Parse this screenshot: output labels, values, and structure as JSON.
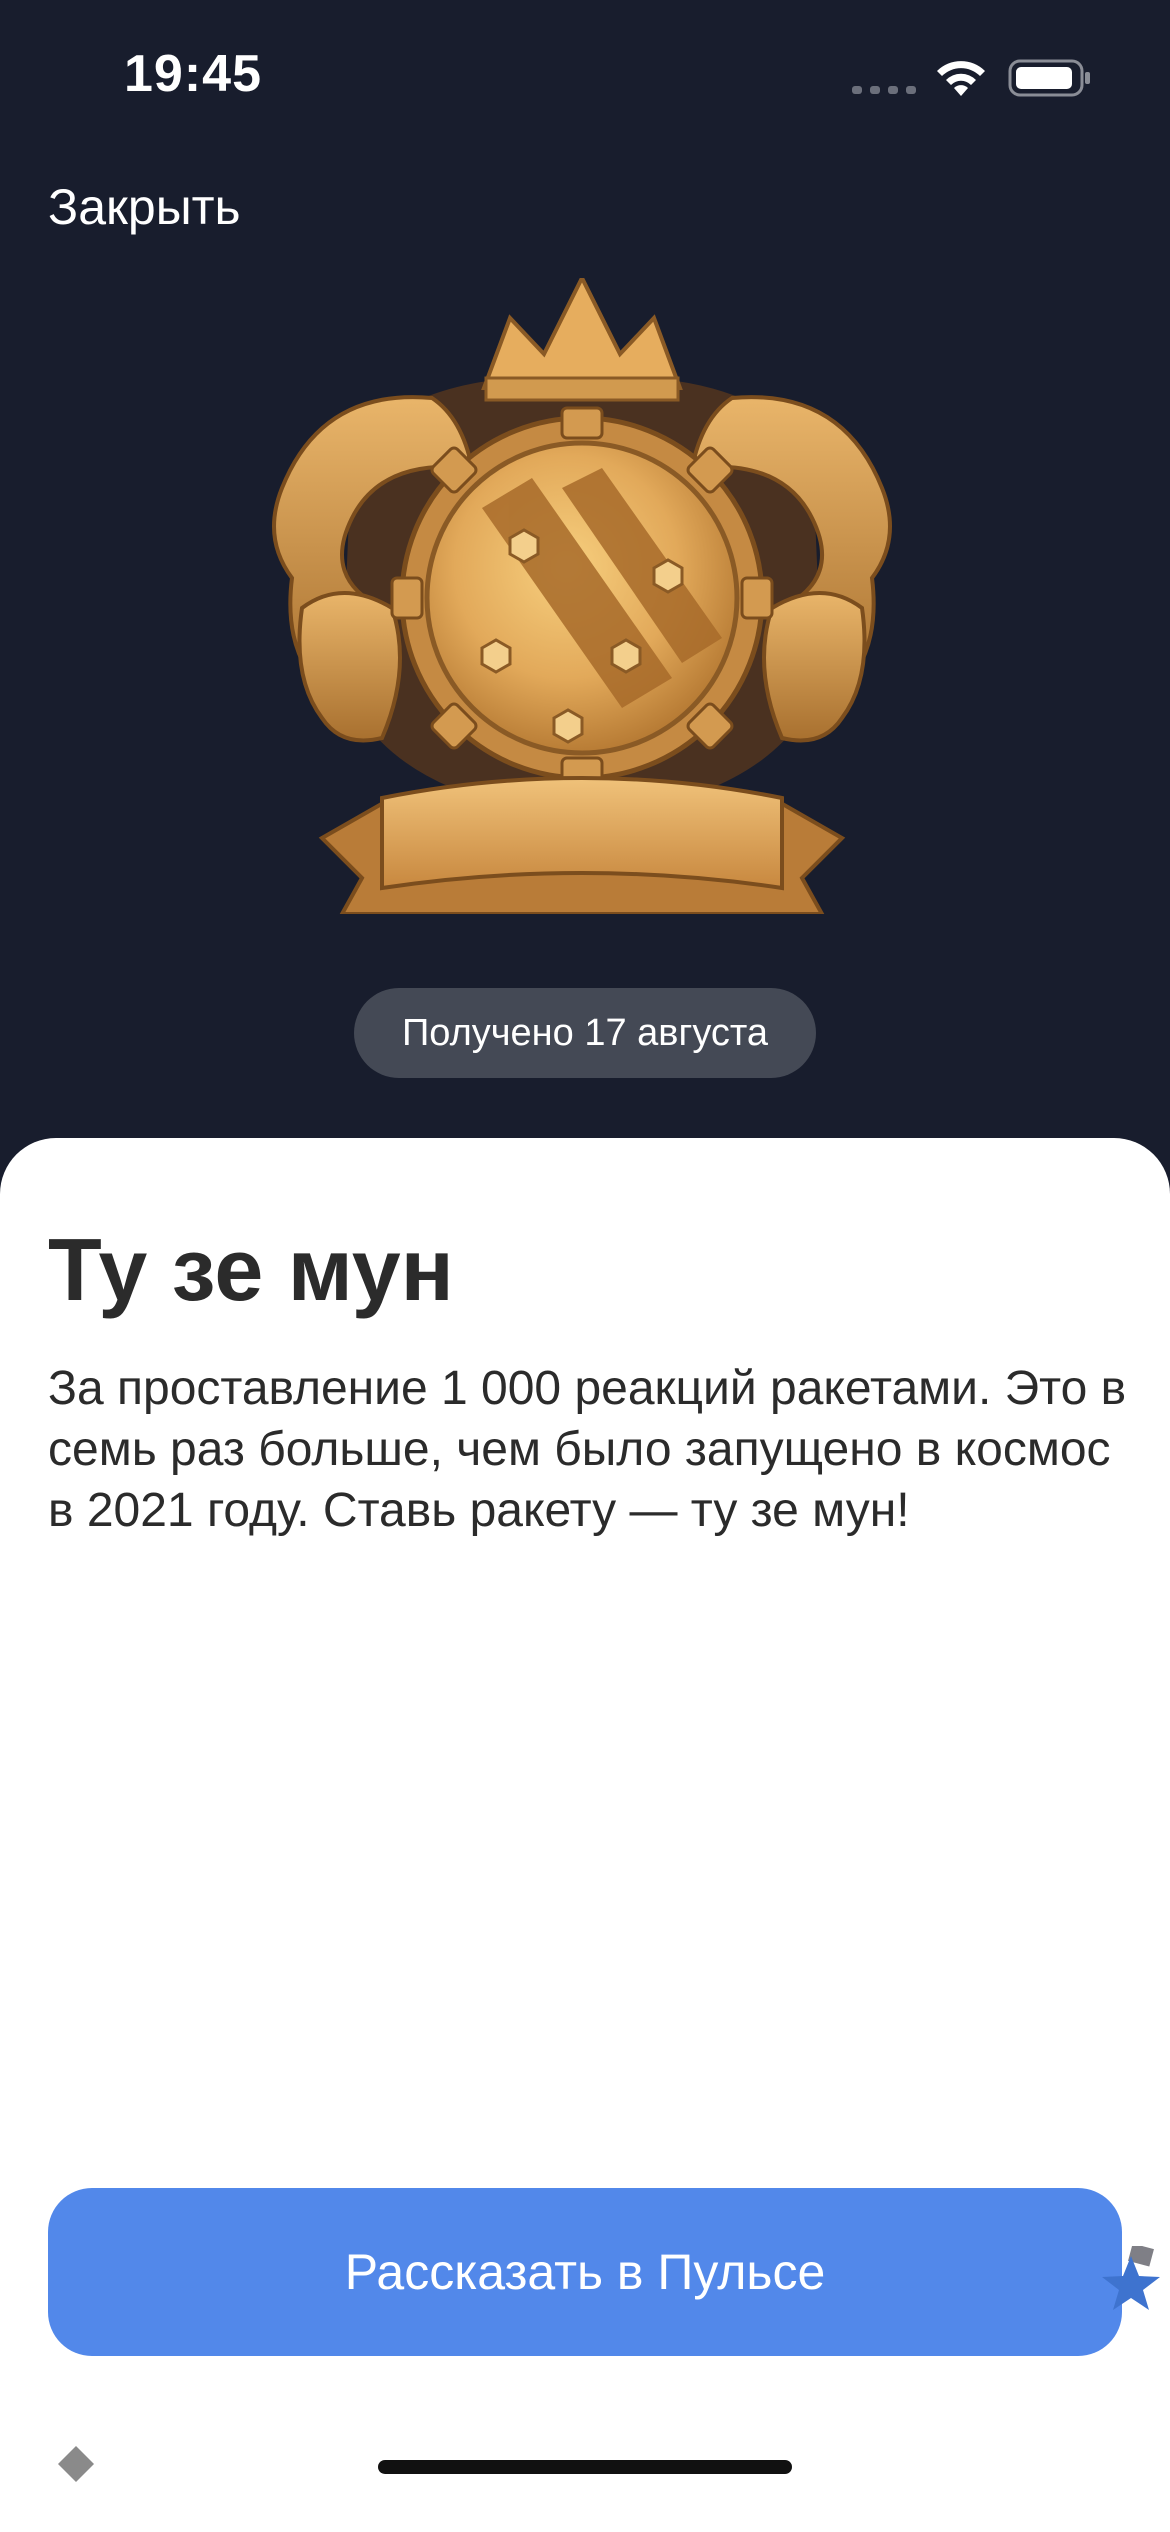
{
  "status_bar": {
    "time": "19:45"
  },
  "header": {
    "close_label": "Закрыть"
  },
  "badge": {
    "received_label": "Получено 17 августа"
  },
  "sheet": {
    "title": "Ту зе мун",
    "description": "За проставление 1 000 реакций ракетами. Это в семь раз больше, чем было запущено в космос в 2021 году. Ставь ракету — ту зе мун!",
    "share_button_label": "Рассказать в Пульсе"
  },
  "colors": {
    "background": "#181d2d",
    "sheet": "#ffffff",
    "accent_button": "#5288ea",
    "pill": "#444955",
    "text_dark": "#2b2b2b",
    "badge_gold": "#d9a255"
  }
}
